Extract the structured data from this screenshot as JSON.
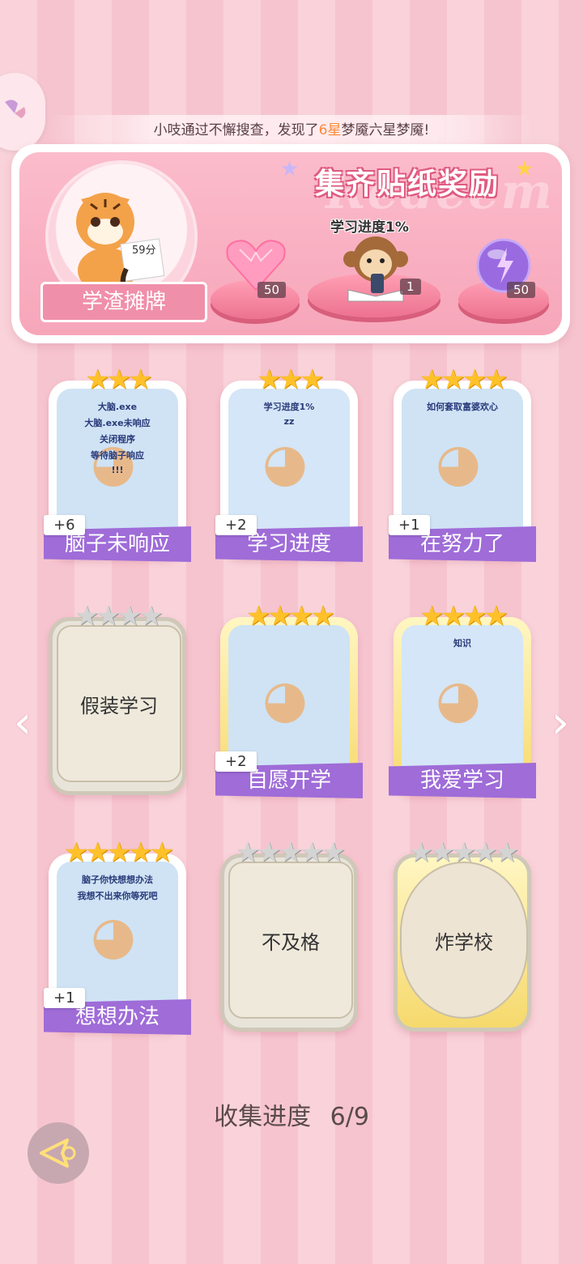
{
  "ticker": {
    "prefix": "小吱通过不懈搜查，发现了",
    "highlight": "6星",
    "suffix": "梦魇六星梦魇!"
  },
  "reward_panel": {
    "title": "集齐贴纸奖励",
    "watermark": "Redeem",
    "avatar_score": "59分",
    "avatar_ribbon": "学渣摊牌",
    "items": [
      {
        "icon": "pink-heart-gem-icon",
        "count": "50"
      },
      {
        "icon": "monkey-phone-sticker-icon",
        "count": "1",
        "caption": "学习进度1%"
      },
      {
        "icon": "purple-lightning-orb-icon",
        "count": "50"
      }
    ]
  },
  "cards": [
    {
      "name": "脑子未响应",
      "plus": "+6",
      "stars_gold": 3,
      "stars_total": 3,
      "state": "unlocked",
      "art_text": [
        "大脑.exe",
        "大脑.exe未响应",
        "关闭程序",
        "等待脑子响应",
        "!!!"
      ]
    },
    {
      "name": "学习进度",
      "plus": "+2",
      "stars_gold": 3,
      "stars_total": 3,
      "state": "unlocked",
      "art_text": [
        "学习进度1%",
        "zz"
      ]
    },
    {
      "name": "在努力了",
      "plus": "+1",
      "stars_gold": 4,
      "stars_total": 4,
      "state": "unlocked",
      "art_text": [
        "如何套取富婆欢心"
      ]
    },
    {
      "name": "假装学习",
      "plus": "",
      "stars_gold": 0,
      "stars_total": 4,
      "state": "locked"
    },
    {
      "name": "自愿开学",
      "plus": "+2",
      "stars_gold": 4,
      "stars_total": 4,
      "state": "unlocked-gold"
    },
    {
      "name": "我爱学习",
      "plus": "",
      "stars_gold": 4,
      "stars_total": 4,
      "state": "unlocked-gold",
      "art_text": [
        "知识"
      ]
    },
    {
      "name": "想想办法",
      "plus": "+1",
      "stars_gold": 5,
      "stars_total": 5,
      "state": "unlocked",
      "art_text": [
        "脑子你快想想办法",
        "我想不出来你等死吧"
      ]
    },
    {
      "name": "不及格",
      "plus": "",
      "stars_gold": 0,
      "stars_total": 5,
      "state": "locked"
    },
    {
      "name": "炸学校",
      "plus": "",
      "stars_gold": 0,
      "stars_total": 5,
      "state": "locked-gold"
    }
  ],
  "collect": {
    "label": "收集进度",
    "value": "6/9"
  },
  "colors": {
    "accent": "#9f6cd8",
    "pink": "#f08fa9",
    "star_gold": "#ffc12a"
  }
}
